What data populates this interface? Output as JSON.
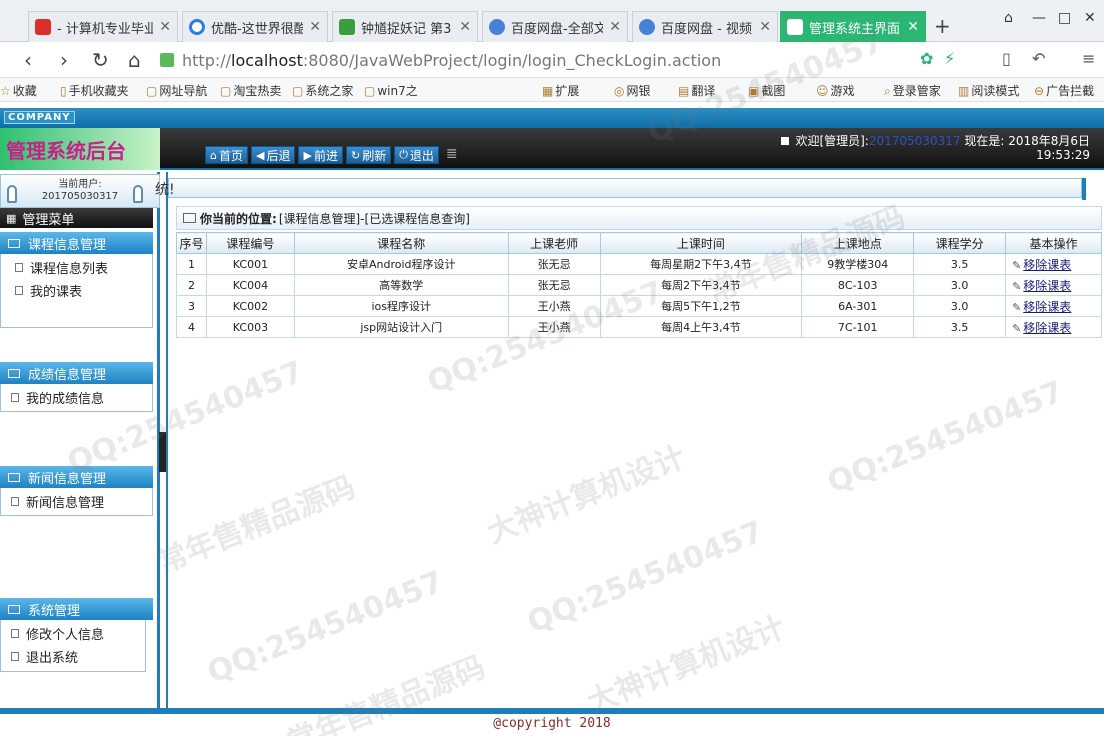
{
  "browser": {
    "tabs": [
      {
        "title": "- 计算机专业毕业",
        "active": false
      },
      {
        "title": "优酷-这世界很酷",
        "active": false
      },
      {
        "title": "钟馗捉妖记 第3",
        "active": false
      },
      {
        "title": "百度网盘-全部文",
        "active": false
      },
      {
        "title": "百度网盘 - 视频",
        "active": false
      },
      {
        "title": "管理系统主界面",
        "active": true
      }
    ],
    "new_tab": "+",
    "url_prefix": "http://",
    "url_host": "localhost",
    "url_path": ":8080/JavaWebProject/login/login_CheckLogin.action",
    "bookmarks": [
      "收藏",
      "手机收藏夹",
      "网址导航",
      "淘宝热卖",
      "系统之家",
      "win7之",
      "扩展",
      "网银",
      "翻译",
      "截图",
      "游戏",
      "登录管家",
      "阅读模式",
      "广告拦截"
    ]
  },
  "app": {
    "company": "COMPANY",
    "brand": "管理系统后台",
    "toolbar": [
      {
        "icon": "home-icon",
        "glyph": "⌂",
        "label": "首页"
      },
      {
        "icon": "back-icon",
        "glyph": "◀",
        "label": "后退"
      },
      {
        "icon": "forward-icon",
        "glyph": "▶",
        "label": "前进"
      },
      {
        "icon": "refresh-icon",
        "glyph": "↻",
        "label": "刷新"
      },
      {
        "icon": "logout-icon",
        "glyph": "⏻",
        "label": "退出"
      }
    ],
    "welcome_prefix": "欢迎[管理员]:",
    "welcome_user": "201705030317",
    "now_label": "现在是:",
    "date": "2018年8月6日",
    "time": "19:53:29"
  },
  "sidebar": {
    "current_user_label": "当前用户:",
    "current_user": "201705030317",
    "menu_title": "管理菜单",
    "sections": [
      {
        "title": "课程信息管理",
        "items": [
          "课程信息列表",
          "我的课表"
        ]
      },
      {
        "title": "成绩信息管理",
        "items": [
          "我的成绩信息"
        ]
      },
      {
        "title": "新闻信息管理",
        "items": [
          "新闻信息管理"
        ]
      },
      {
        "title": "系统管理",
        "items": [
          "修改个人信息",
          "退出系统"
        ]
      }
    ]
  },
  "content": {
    "banner": "统!",
    "location_label": "你当前的位置:",
    "location_path": "[课程信息管理]-[已选课程信息查询]",
    "table": {
      "headers": [
        "序号",
        "课程编号",
        "课程名称",
        "上课老师",
        "上课时间",
        "上课地点",
        "课程学分",
        "基本操作"
      ],
      "rows": [
        {
          "no": "1",
          "code": "KC001",
          "name": "安卓Android程序设计",
          "teacher": "张无忌",
          "time": "每周星期2下午3,4节",
          "place": "9教学楼304",
          "credit": "3.5",
          "action": "移除课表"
        },
        {
          "no": "2",
          "code": "KC004",
          "name": "高等数学",
          "teacher": "张无忌",
          "time": "每周2下午3,4节",
          "place": "8C-103",
          "credit": "3.0",
          "action": "移除课表"
        },
        {
          "no": "3",
          "code": "KC002",
          "name": "ios程序设计",
          "teacher": "王小燕",
          "time": "每周5下午1,2节",
          "place": "6A-301",
          "credit": "3.0",
          "action": "移除课表"
        },
        {
          "no": "4",
          "code": "KC003",
          "name": "jsp网站设计入门",
          "teacher": "王小燕",
          "time": "每周4上午3,4节",
          "place": "7C-101",
          "credit": "3.5",
          "action": "移除课表"
        }
      ]
    }
  },
  "footer": "@copyright 2018",
  "watermarks": [
    "QQ:254540457",
    "常年售精品源码",
    "大神计算机设计"
  ]
}
